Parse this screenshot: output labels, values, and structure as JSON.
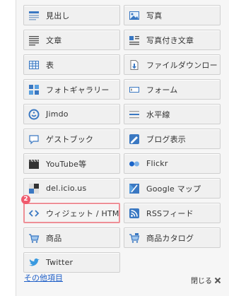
{
  "items": [
    {
      "label": "見出し",
      "icon": "heading-icon"
    },
    {
      "label": "写真",
      "icon": "photo-icon"
    },
    {
      "label": "文章",
      "icon": "text-icon"
    },
    {
      "label": "写真付き文章",
      "icon": "text-with-photo-icon"
    },
    {
      "label": "表",
      "icon": "table-icon"
    },
    {
      "label": "ファイルダウンロード",
      "icon": "file-download-icon"
    },
    {
      "label": "フォトギャラリー",
      "icon": "photo-gallery-icon"
    },
    {
      "label": "フォーム",
      "icon": "form-icon"
    },
    {
      "label": "Jimdo",
      "icon": "jimdo-icon"
    },
    {
      "label": "水平線",
      "icon": "horizontal-line-icon"
    },
    {
      "label": "ゲストブック",
      "icon": "guestbook-icon"
    },
    {
      "label": "ブログ表示",
      "icon": "blog-icon"
    },
    {
      "label": "YouTube等",
      "icon": "video-icon"
    },
    {
      "label": "Flickr",
      "icon": "flickr-icon"
    },
    {
      "label": "del.icio.us",
      "icon": "delicious-icon"
    },
    {
      "label": "Google マップ",
      "icon": "google-map-icon"
    },
    {
      "label": "ウィジェット / HTML",
      "icon": "widget-html-icon"
    },
    {
      "label": "RSSフィード",
      "icon": "rss-icon"
    },
    {
      "label": "商品",
      "icon": "cart-icon"
    },
    {
      "label": "商品カタログ",
      "icon": "catalog-icon"
    },
    {
      "label": "Twitter",
      "icon": "twitter-icon"
    }
  ],
  "highlight_badge": "2",
  "footer": {
    "other_items": "その他項目",
    "close": "閉じる"
  },
  "colors": {
    "highlight_border": "#ee8f96",
    "badge": "#f05a6d",
    "link": "#2060c8"
  }
}
